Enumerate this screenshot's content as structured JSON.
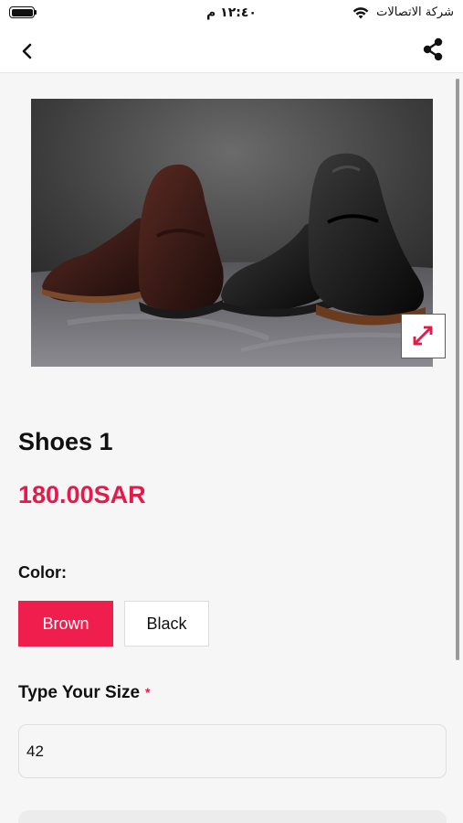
{
  "status_bar": {
    "time": "١٢:٤٠ م",
    "carrier": "شركة الاتصالات"
  },
  "nav": {
    "back_icon": "chevron-left-icon",
    "share_icon": "share-icon"
  },
  "product": {
    "image_alt": "shoes photo",
    "expand_icon": "expand-arrows-icon",
    "title": "Shoes 1",
    "price": "180.00SAR"
  },
  "color": {
    "label": "Color:",
    "options": [
      {
        "label": "Brown",
        "selected": true
      },
      {
        "label": "Black",
        "selected": false
      }
    ]
  },
  "size": {
    "label": "Type Your Size",
    "required_mark": "*",
    "value": "42"
  },
  "colors": {
    "accent": "#e8194a",
    "background": "#f6f6f6"
  }
}
